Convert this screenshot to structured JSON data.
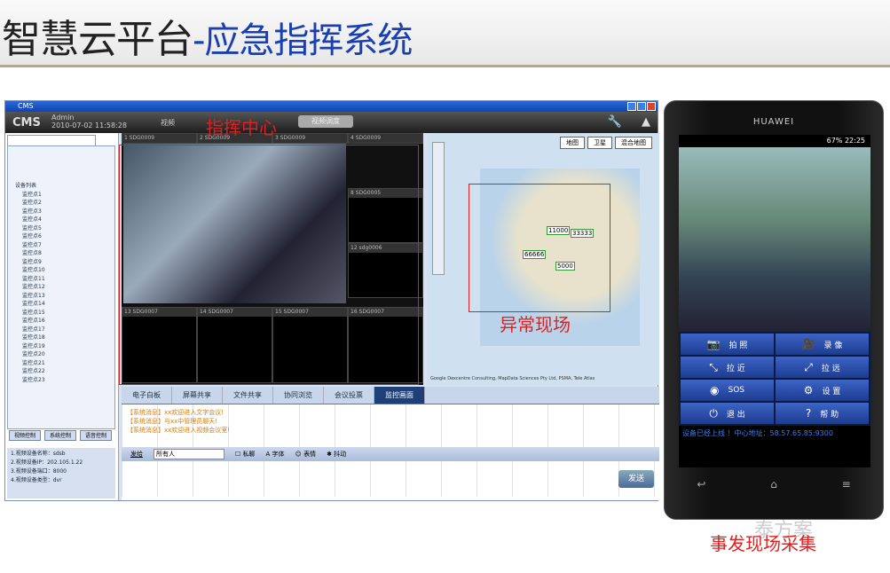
{
  "title": {
    "main": "智慧云平台",
    "sub": "-应急指挥系统"
  },
  "app": {
    "window_title": "CMS",
    "logo": "CMS",
    "user": "Admin",
    "datetime": "2010-07-02 11:58:28",
    "nav1": "视频",
    "nav2": "视频调度",
    "tree": [
      "设备列表",
      "监控点1",
      "监控点2",
      "监控点3",
      "监控点4",
      "监控点5",
      "监控点6",
      "监控点7",
      "监控点8",
      "监控点9",
      "监控点10",
      "监控点11",
      "监控点12",
      "监控点13",
      "监控点14",
      "监控点15",
      "监控点16",
      "监控点17",
      "监控点18",
      "监控点19",
      "监控点20",
      "监控点21",
      "监控点22",
      "监控点23"
    ],
    "left_buttons": [
      "视频控制",
      "系统控制",
      "语音控制"
    ],
    "left_info": [
      "1.视频设备名称：sdsb",
      "2.视频设备IP：202.105.1.22",
      "3.视频设备端口：8000",
      "4.视频设备类型：dvr"
    ],
    "cells": [
      "1 SDG0009",
      "2 SDG0009",
      "3 SDG0009",
      "4 SDG0009",
      "8 SDG0005",
      "12 sdg0006",
      "13 SDG0007",
      "14 SDG0007",
      "15 SDG0007",
      "16 SDG0007"
    ],
    "map_buttons": [
      "地图",
      "卫星",
      "混合地图"
    ],
    "map_labels": [
      "11000",
      "33333",
      "66666",
      "5000"
    ],
    "map_credit": "Google  Dexcentre Consulting, MapData Sciences Pty Ltd, PSMA, Tele Atlas",
    "tabs": [
      "电子白板",
      "屏幕共享",
      "文件共享",
      "协同浏览",
      "会议投票",
      "监控画面"
    ],
    "messages": [
      "【系统消息】xx欢迎进入文字会议!",
      "【系统消息】与xx中管理员聊天!",
      "【系统消息】xx欢迎进入视频会议室!"
    ],
    "tools": {
      "send_to": "发给",
      "select": "所有人",
      "private": "私聊",
      "font": "字体",
      "emoji": "表情",
      "shake": "抖动"
    },
    "send": "发送"
  },
  "annotations": {
    "command": "指挥中心",
    "scene": "异常现场",
    "capture": "事发现场采集"
  },
  "phone": {
    "brand": "HUAWEI",
    "battery": "67%",
    "time": "22:25",
    "buttons": [
      {
        "icon": "📷",
        "label": "拍 照"
      },
      {
        "icon": "🎥",
        "label": "录 像"
      },
      {
        "icon": "⤡",
        "label": "拉 近"
      },
      {
        "icon": "⤢",
        "label": "拉 远"
      },
      {
        "icon": "◉",
        "label": "SOS"
      },
      {
        "icon": "⚙",
        "label": "设 置"
      },
      {
        "icon": "⏻",
        "label": "退 出"
      },
      {
        "icon": "?",
        "label": "帮 助"
      }
    ],
    "status": "设备已经上线 ！中心地址：58.57.65.85:9300",
    "keys": [
      "↩",
      "⌂",
      "≡"
    ]
  },
  "watermark": "泰方案"
}
